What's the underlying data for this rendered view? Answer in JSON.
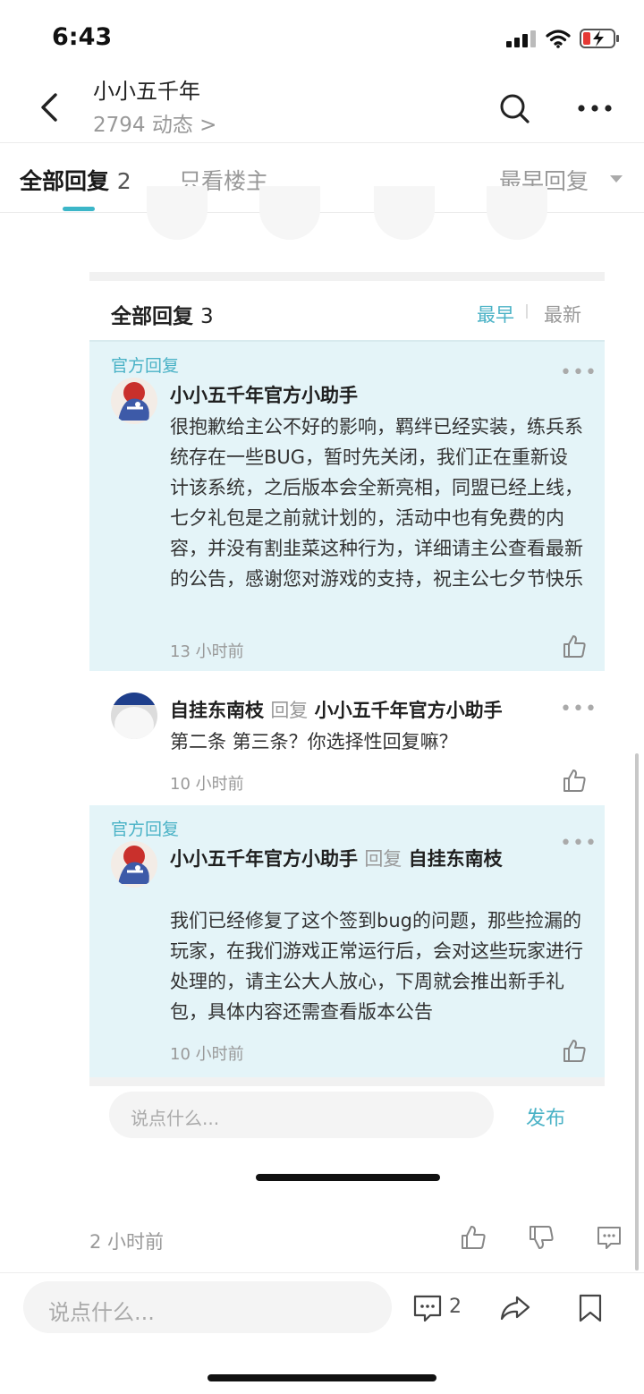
{
  "status_bar": {
    "time": "6:43"
  },
  "header": {
    "title": "小小五千年",
    "subtitle": "2794 动态 >"
  },
  "tabs": {
    "all_label": "全部回复",
    "all_count": "2",
    "owner_only": "只看楼主",
    "sort": "最早回复"
  },
  "panel": {
    "heading": "全部回复",
    "count": "3",
    "sort_early": "最早",
    "sort_latest": "最新"
  },
  "replies": [
    {
      "official_label": "官方回复",
      "author": "小小五千年官方小助手",
      "text": "很抱歉给主公不好的影响，羁绊已经实装，练兵系统存在一些BUG，暂时先关闭，我们正在重新设计该系统，之后版本会全新亮相，同盟已经上线，七夕礼包是之前就计划的，活动中也有免费的内容，并没有割韭菜这种行为，详细请主公查看最新的公告，感谢您对游戏的支持，祝主公七夕节快乐",
      "time": "13 小时前"
    },
    {
      "author": "自挂东南枝",
      "reply_word": "回复",
      "reply_to": "小小五千年官方小助手",
      "text": "第二条 第三条？你选择性回复嘛？",
      "time": "10 小时前"
    },
    {
      "official_label": "官方回复",
      "author": "小小五千年官方小助手",
      "reply_word": "回复",
      "reply_to": "自挂东南枝",
      "text": "我们已经修复了这个签到bug的问题，那些捡漏的玩家，在我们游戏正常运行后，会对这些玩家进行处理的，请主公大人放心，下周就会推出新手礼包，具体内容还需查看版本公告",
      "time": "10 小时前"
    }
  ],
  "comment_box": {
    "placeholder": "说点什么...",
    "publish": "发布"
  },
  "post": {
    "time": "2 小时前"
  },
  "bottom_bar": {
    "placeholder": "说点什么...",
    "comment_count": "2"
  },
  "colors": {
    "accent": "#4ab2c6",
    "official_bg": "#e4f4f8"
  }
}
